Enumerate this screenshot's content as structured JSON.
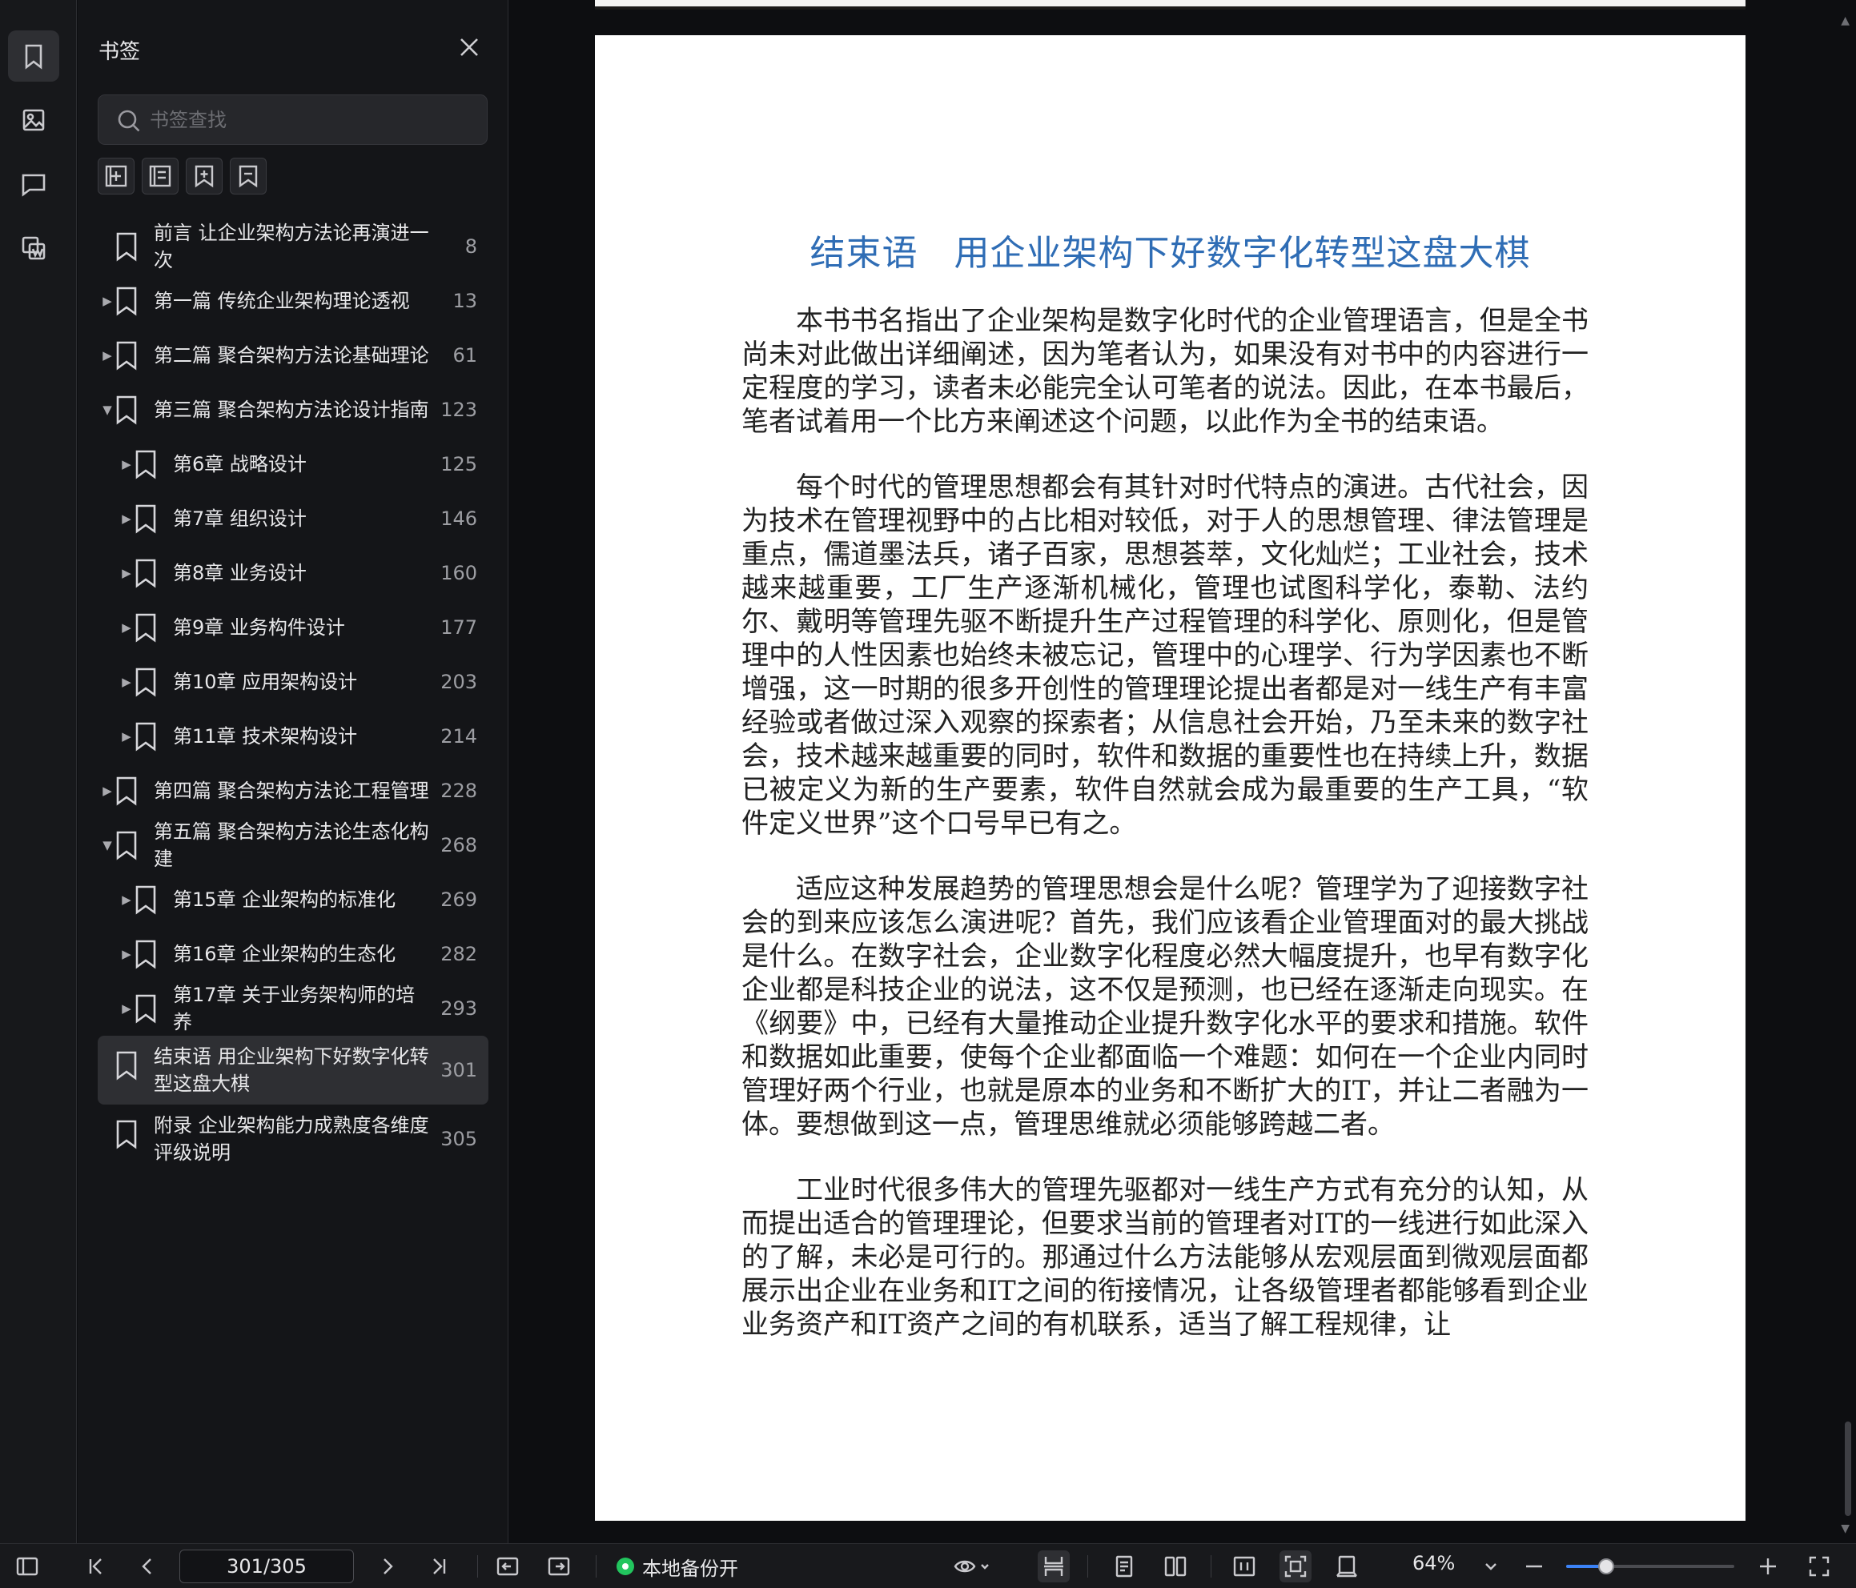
{
  "panel": {
    "title": "书签",
    "search_placeholder": "书签查找"
  },
  "bookmarks": [
    {
      "label": "前言 让企业架构方法论再演进一次",
      "page": "8",
      "level": 0,
      "expand": "none"
    },
    {
      "label": "第一篇 传统企业架构理论透视",
      "page": "13",
      "level": 0,
      "expand": "collapsed"
    },
    {
      "label": "第二篇 聚合架构方法论基础理论",
      "page": "61",
      "level": 0,
      "expand": "collapsed"
    },
    {
      "label": "第三篇 聚合架构方法论设计指南",
      "page": "123",
      "level": 0,
      "expand": "expanded"
    },
    {
      "label": "第6章 战略设计",
      "page": "125",
      "level": 1,
      "expand": "collapsed"
    },
    {
      "label": "第7章 组织设计",
      "page": "146",
      "level": 1,
      "expand": "collapsed"
    },
    {
      "label": "第8章 业务设计",
      "page": "160",
      "level": 1,
      "expand": "collapsed"
    },
    {
      "label": "第9章 业务构件设计",
      "page": "177",
      "level": 1,
      "expand": "collapsed"
    },
    {
      "label": "第10章 应用架构设计",
      "page": "203",
      "level": 1,
      "expand": "collapsed"
    },
    {
      "label": "第11章 技术架构设计",
      "page": "214",
      "level": 1,
      "expand": "collapsed"
    },
    {
      "label": "第四篇 聚合架构方法论工程管理",
      "page": "228",
      "level": 0,
      "expand": "collapsed"
    },
    {
      "label": "第五篇 聚合架构方法论生态化构建",
      "page": "268",
      "level": 0,
      "expand": "expanded"
    },
    {
      "label": "第15章 企业架构的标准化",
      "page": "269",
      "level": 1,
      "expand": "collapsed"
    },
    {
      "label": "第16章 企业架构的生态化",
      "page": "282",
      "level": 1,
      "expand": "collapsed"
    },
    {
      "label": "第17章 关于业务架构师的培养",
      "page": "293",
      "level": 1,
      "expand": "collapsed"
    },
    {
      "label": "结束语 用企业架构下好数字化转型这盘大棋",
      "page": "301",
      "level": 0,
      "expand": "none",
      "selected": true
    },
    {
      "label": "附录 企业架构能力成熟度各维度评级说明",
      "page": "305",
      "level": 0,
      "expand": "none"
    }
  ],
  "document": {
    "title": "结束语　用企业架构下好数字化转型这盘大棋",
    "paragraphs": [
      "本书书名指出了企业架构是数字化时代的企业管理语言，但是全书尚未对此做出详细阐述，因为笔者认为，如果没有对书中的内容进行一定程度的学习，读者未必能完全认可笔者的说法。因此，在本书最后，笔者试着用一个比方来阐述这个问题，以此作为全书的结束语。",
      "每个时代的管理思想都会有其针对时代特点的演进。古代社会，因为技术在管理视野中的占比相对较低，对于人的思想管理、律法管理是重点，儒道墨法兵，诸子百家，思想荟萃，文化灿烂；工业社会，技术越来越重要，工厂生产逐渐机械化，管理也试图科学化，泰勒、法约尔、戴明等管理先驱不断提升生产过程管理的科学化、原则化，但是管理中的人性因素也始终未被忘记，管理中的心理学、行为学因素也不断增强，这一时期的很多开创性的管理理论提出者都是对一线生产有丰富经验或者做过深入观察的探索者；从信息社会开始，乃至未来的数字社会，技术越来越重要的同时，软件和数据的重要性也在持续上升，数据已被定义为新的生产要素，软件自然就会成为最重要的生产工具，“软件定义世界”这个口号早已有之。",
      "适应这种发展趋势的管理思想会是什么呢？管理学为了迎接数字社会的到来应该怎么演进呢？首先，我们应该看企业管理面对的最大挑战是什么。在数字社会，企业数字化程度必然大幅度提升，也早有数字化企业都是科技企业的说法，这不仅是预测，也已经在逐渐走向现实。在《纲要》中，已经有大量推动企业提升数字化水平的要求和措施。软件和数据如此重要，使每个企业都面临一个难题：如何在一个企业内同时管理好两个行业，也就是原本的业务和不断扩大的IT，并让二者融为一体。要想做到这一点，管理思维就必须能够跨越二者。",
      "工业时代很多伟大的管理先驱都对一线生产方式有充分的认知，从而提出适合的管理理论，但要求当前的管理者对IT的一线进行如此深入的了解，未必是可行的。那通过什么方法能够从宏观层面到微观层面都展示出企业在业务和IT之间的衔接情况，让各级管理者都能够看到企业业务资产和IT资产之间的有机联系，适当了解工程规律，让"
    ]
  },
  "toolbar": {
    "page_indicator": "301/305",
    "current_page": 301,
    "total_pages": 305,
    "backup_label": "本地备份开",
    "backup_status_color": "#22c55e",
    "zoom_label": "64%",
    "zoom_level": 0.24
  }
}
